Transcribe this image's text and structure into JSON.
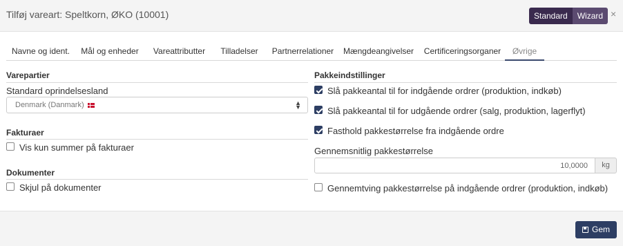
{
  "dialog": {
    "title": "Tilføj vareart: Speltkorn, ØKO (10001)",
    "mode_standard": "Standard",
    "mode_wizard": "Wizard",
    "close": "×"
  },
  "tabs": [
    {
      "label": "Navne og ident.",
      "active": false
    },
    {
      "label": "Mål og enheder",
      "active": false
    },
    {
      "label": "Vareattributter",
      "active": false
    },
    {
      "label": "Tilladelser",
      "active": false
    },
    {
      "label": "Partnerrelationer",
      "active": false
    },
    {
      "label": "Mængdeangivelser",
      "active": false
    },
    {
      "label": "Certificeringsorganer",
      "active": false
    },
    {
      "label": "Øvrige",
      "active": true
    }
  ],
  "left": {
    "varepartier": {
      "title": "Varepartier",
      "origin_label": "Standard oprindelsesland",
      "origin_value": "Denmark (Danmark)"
    },
    "fakturaer": {
      "title": "Fakturaer",
      "summary_only_label": "Vis kun summer på fakturaer",
      "summary_only_checked": false
    },
    "dokumenter": {
      "title": "Dokumenter",
      "hide_label": "Skjul på dokumenter",
      "hide_checked": false
    }
  },
  "right": {
    "title": "Pakkeindstillinger",
    "options": [
      {
        "label": "Slå pakkeantal til for indgående ordrer (produktion, indkøb)",
        "checked": true
      },
      {
        "label": "Slå pakkeantal til for udgående ordrer (salg, produktion, lagerflyt)",
        "checked": true
      },
      {
        "label": "Fasthold pakkestørrelse fra indgående ordre",
        "checked": true
      }
    ],
    "avg_size_label": "Gennemsnitlig pakkestørrelse",
    "avg_size_value": "10,0000",
    "avg_size_unit": "kg",
    "enforce_label": "Gennemtving pakkestørrelse på indgående ordrer (produktion, indkøb)",
    "enforce_checked": false
  },
  "footer": {
    "save_label": "Gem"
  },
  "colors": {
    "primary": "#2d3e63",
    "mode_standard_bg": "#3a2a4e",
    "mode_wizard_bg": "#5b4a70"
  }
}
